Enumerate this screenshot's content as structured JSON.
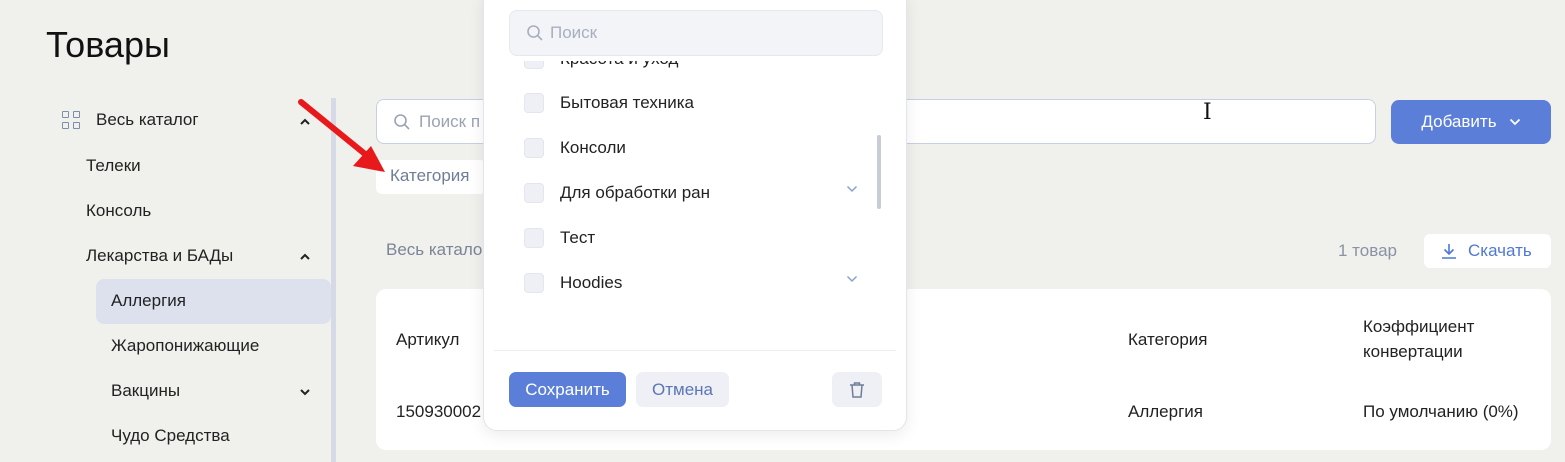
{
  "page": {
    "title": "Товары"
  },
  "sidebar": {
    "root": "Весь каталог",
    "items": [
      {
        "label": "Телеки"
      },
      {
        "label": "Консоль"
      },
      {
        "label": "Лекарства и БАДы"
      },
      {
        "label": "Аллергия"
      },
      {
        "label": "Жаропонижающие"
      },
      {
        "label": "Вакцины"
      },
      {
        "label": "Чудо Средства"
      }
    ]
  },
  "search": {
    "placeholder": "Поиск п"
  },
  "toolbar": {
    "add_label": "Добавить",
    "category_filter": "Категория"
  },
  "breadcrumb": "Весь катало",
  "summary": {
    "count": "1 товар",
    "download_label": "Скачать"
  },
  "table": {
    "headers": {
      "sku": "Артикул",
      "category": "Категория",
      "conversion_line1": "Коэффициент",
      "conversion_line2": "конвертации"
    },
    "rows": [
      {
        "sku": "150930002",
        "category": "Аллергия",
        "conversion": "По умолчанию (0%)"
      }
    ]
  },
  "dropdown": {
    "search_placeholder": "Поиск",
    "items": [
      {
        "label": "Красота и уход"
      },
      {
        "label": "Бытовая техника"
      },
      {
        "label": "Консоли"
      },
      {
        "label": "Для обработки ран"
      },
      {
        "label": "Тест"
      },
      {
        "label": "Hoodies"
      }
    ],
    "save_label": "Сохранить",
    "cancel_label": "Отмена"
  },
  "colors": {
    "accent": "#5b7fd8",
    "selected_bg": "#dde1ee",
    "annotation_arrow": "#e8191a"
  }
}
